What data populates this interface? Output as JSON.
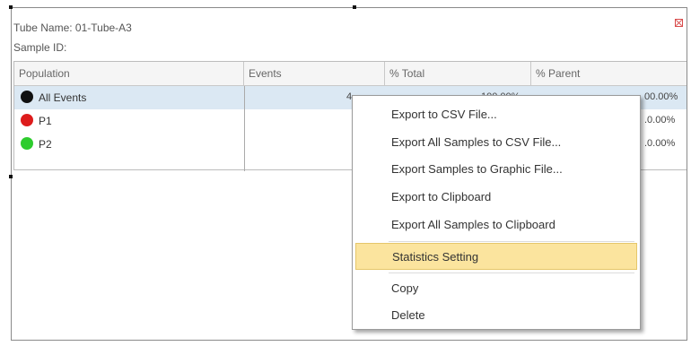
{
  "info": {
    "tube_name": "Tube Name: 01-Tube-A3",
    "sample_id": "Sample ID:"
  },
  "table": {
    "columns": [
      "Population",
      "Events",
      "% Total",
      "% Parent"
    ],
    "rows": [
      {
        "label": "All Events",
        "color": "#111111",
        "events_partial": "4",
        "total_partial": "100.00%",
        "parent_partial": "00.00%"
      },
      {
        "label": "P1",
        "color": "#dd1c1c",
        "events_partial": "",
        "total_partial": "",
        "parent_partial": ".0.00%"
      },
      {
        "label": "P2",
        "color": "#2ecc2e",
        "events_partial": "",
        "total_partial": "",
        "parent_partial": ".0.00%"
      }
    ]
  },
  "context_menu": {
    "items": [
      "Export to CSV File...",
      "Export All Samples to CSV File...",
      "Export Samples to Graphic File...",
      "Export to Clipboard",
      "Export All Samples to Clipboard",
      "Statistics Setting",
      "Copy",
      "Delete"
    ],
    "highlighted_index": 5,
    "highlight_color": "#fbe49e"
  }
}
